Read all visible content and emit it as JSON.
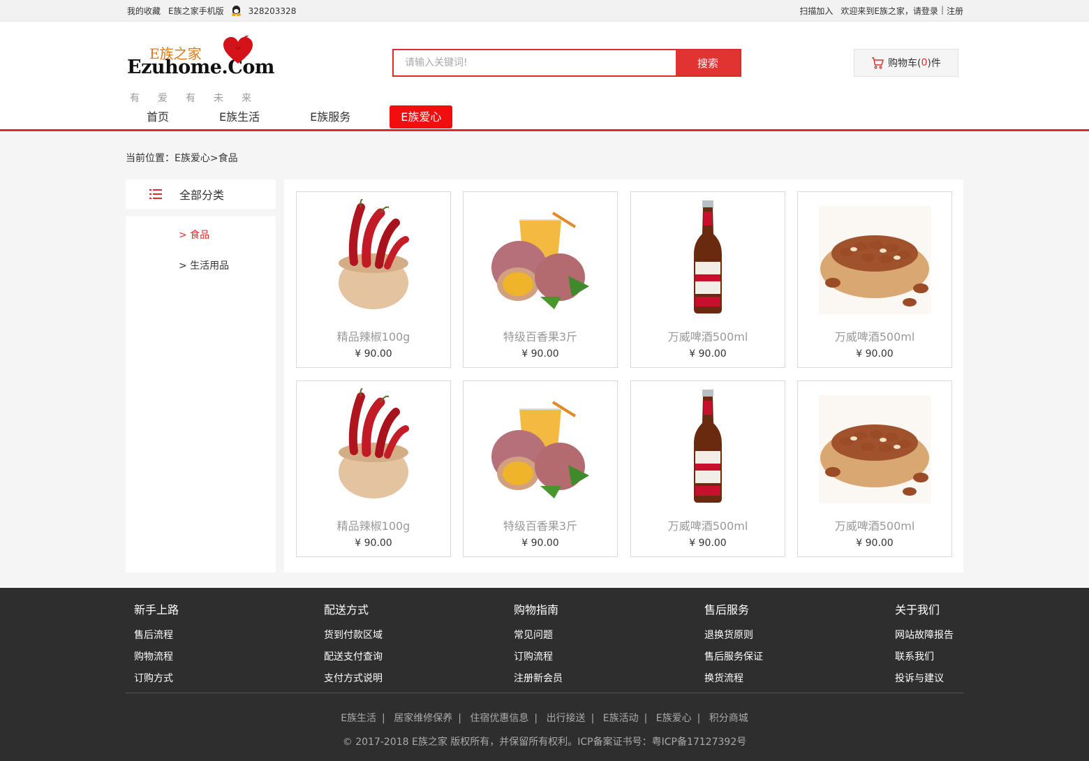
{
  "topbar": {
    "favorites": "我的收藏",
    "mobile": "E族之家手机版",
    "qq": "328203328",
    "scan": "扫描加入",
    "welcome": "欢迎来到E族之家，",
    "login": "请登录",
    "register": "注册",
    "sep": "|"
  },
  "logo": {
    "cn": "E族之家",
    "en": "Ezuhome.Com",
    "slogan": "有爱有未来"
  },
  "search": {
    "placeholder": "请输入关键词!",
    "button": "搜索"
  },
  "cart": {
    "prefix": "购物车(",
    "count": "0",
    "suffix": ")件"
  },
  "nav": [
    "首页",
    "E族生活",
    "E族服务",
    "E族爱心"
  ],
  "breadcrumb": "当前位置：E族爱心>食品",
  "sidebar": {
    "title": "全部分类",
    "categories": [
      "> 食品",
      "> 生活用品"
    ]
  },
  "products": [
    {
      "name": "精品辣椒100g",
      "price": "¥ 90.00",
      "image": "chili-bowl"
    },
    {
      "name": "特级百香果3斤",
      "price": "¥ 90.00",
      "image": "passion-fruit"
    },
    {
      "name": "万威啤酒500ml",
      "price": "¥ 90.00",
      "image": "beer-bottle"
    },
    {
      "name": "万威啤酒500ml",
      "price": "¥ 90.00",
      "image": "pine-nuts-bowl"
    },
    {
      "name": "精品辣椒100g",
      "price": "¥ 90.00",
      "image": "chili-bowl"
    },
    {
      "name": "特级百香果3斤",
      "price": "¥ 90.00",
      "image": "passion-fruit"
    },
    {
      "name": "万威啤酒500ml",
      "price": "¥ 90.00",
      "image": "beer-bottle"
    },
    {
      "name": "万威啤酒500ml",
      "price": "¥ 90.00",
      "image": "pine-nuts-bowl"
    }
  ],
  "footer": {
    "columns": [
      {
        "title": "新手上路",
        "links": [
          "售后流程",
          "购物流程",
          "订购方式"
        ]
      },
      {
        "title": "配送方式",
        "links": [
          "货到付款区域",
          "配送支付查询",
          "支付方式说明"
        ]
      },
      {
        "title": "购物指南",
        "links": [
          "常见问题",
          "订购流程",
          "注册新会员"
        ]
      },
      {
        "title": "售后服务",
        "links": [
          "退换货原则",
          "售后服务保证",
          "换货流程"
        ]
      },
      {
        "title": "关于我们",
        "links": [
          "网站故障报告",
          "联系我们",
          "投诉与建议"
        ]
      }
    ],
    "bottom_links": [
      "E族生活",
      "居家维修保养",
      "住宿优惠信息",
      "出行接送",
      "E族活动",
      "E族爱心",
      "积分商城"
    ],
    "copyright": "© 2017-2018 E族之家 版权所有，并保留所有权利。ICP备案证书号：粤ICP备17127392号"
  },
  "colors": {
    "accent": "#e02a2a",
    "footer_bg": "#2e2e2e"
  }
}
